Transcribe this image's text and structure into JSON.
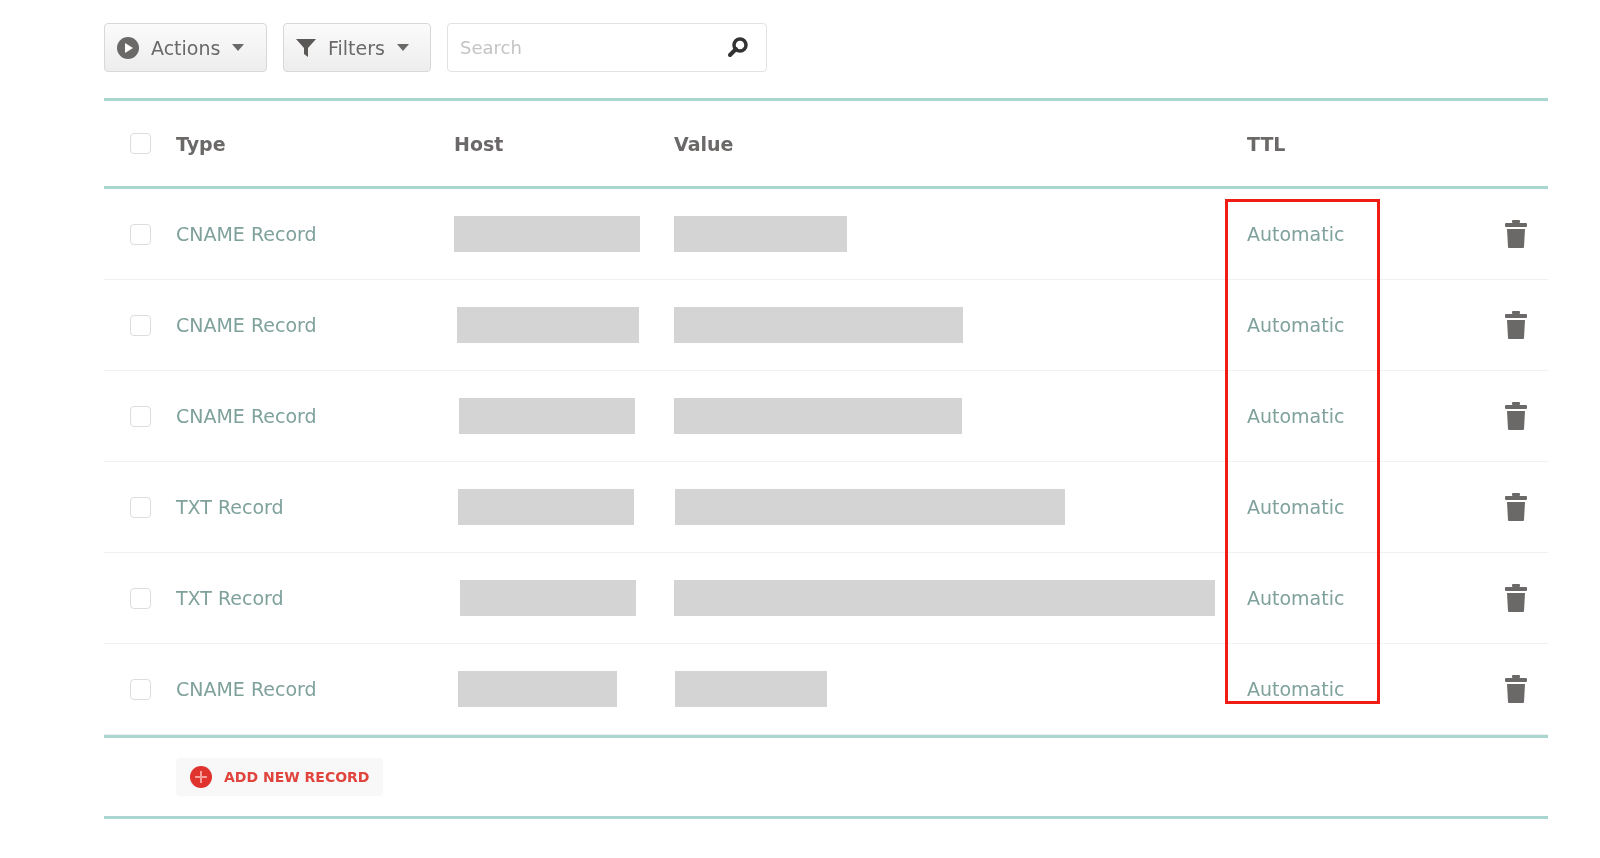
{
  "toolbar": {
    "actions_button": "Actions",
    "filters_button": "Filters",
    "search": {
      "placeholder": "Search"
    }
  },
  "table": {
    "select_all": {
      "checked": false
    },
    "columns": [
      "Type",
      "Host",
      "Value",
      "TTL"
    ],
    "rows": [
      {
        "checked": false,
        "type": "CNAME Record",
        "ttl": "Automatic"
      },
      {
        "checked": false,
        "type": "CNAME Record",
        "ttl": "Automatic"
      },
      {
        "checked": false,
        "type": "CNAME Record",
        "ttl": "Automatic"
      },
      {
        "checked": false,
        "type": "TXT Record",
        "ttl": "Automatic"
      },
      {
        "checked": false,
        "type": "TXT Record",
        "ttl": "Automatic"
      },
      {
        "checked": false,
        "type": "CNAME Record",
        "ttl": "Automatic"
      }
    ]
  },
  "add_button": "ADD NEW RECORD"
}
